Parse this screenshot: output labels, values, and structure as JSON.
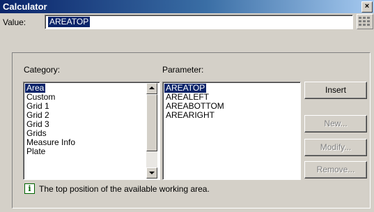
{
  "window": {
    "title": "Calculator",
    "close_glyph": "×"
  },
  "value": {
    "label": "Value:",
    "text": "AREATOP"
  },
  "category": {
    "label": "Category:",
    "items": [
      "Area",
      "Custom",
      "Grid 1",
      "Grid 2",
      "Grid 3",
      "Grids",
      "Measure Info",
      "Plate"
    ],
    "selected": "Area"
  },
  "parameter": {
    "label": "Parameter:",
    "items": [
      "AREATOP",
      "AREALEFT",
      "AREABOTTOM",
      "AREARIGHT"
    ],
    "selected": "AREATOP"
  },
  "buttons": {
    "insert": "Insert",
    "new": "New...",
    "modify": "Modify...",
    "remove": "Remove..."
  },
  "info": {
    "icon_glyph": "i",
    "text": "The top position of the available working area."
  },
  "colors": {
    "selection": "#0a246a",
    "titlebar_start": "#0a246a",
    "info_icon": "#006400"
  }
}
